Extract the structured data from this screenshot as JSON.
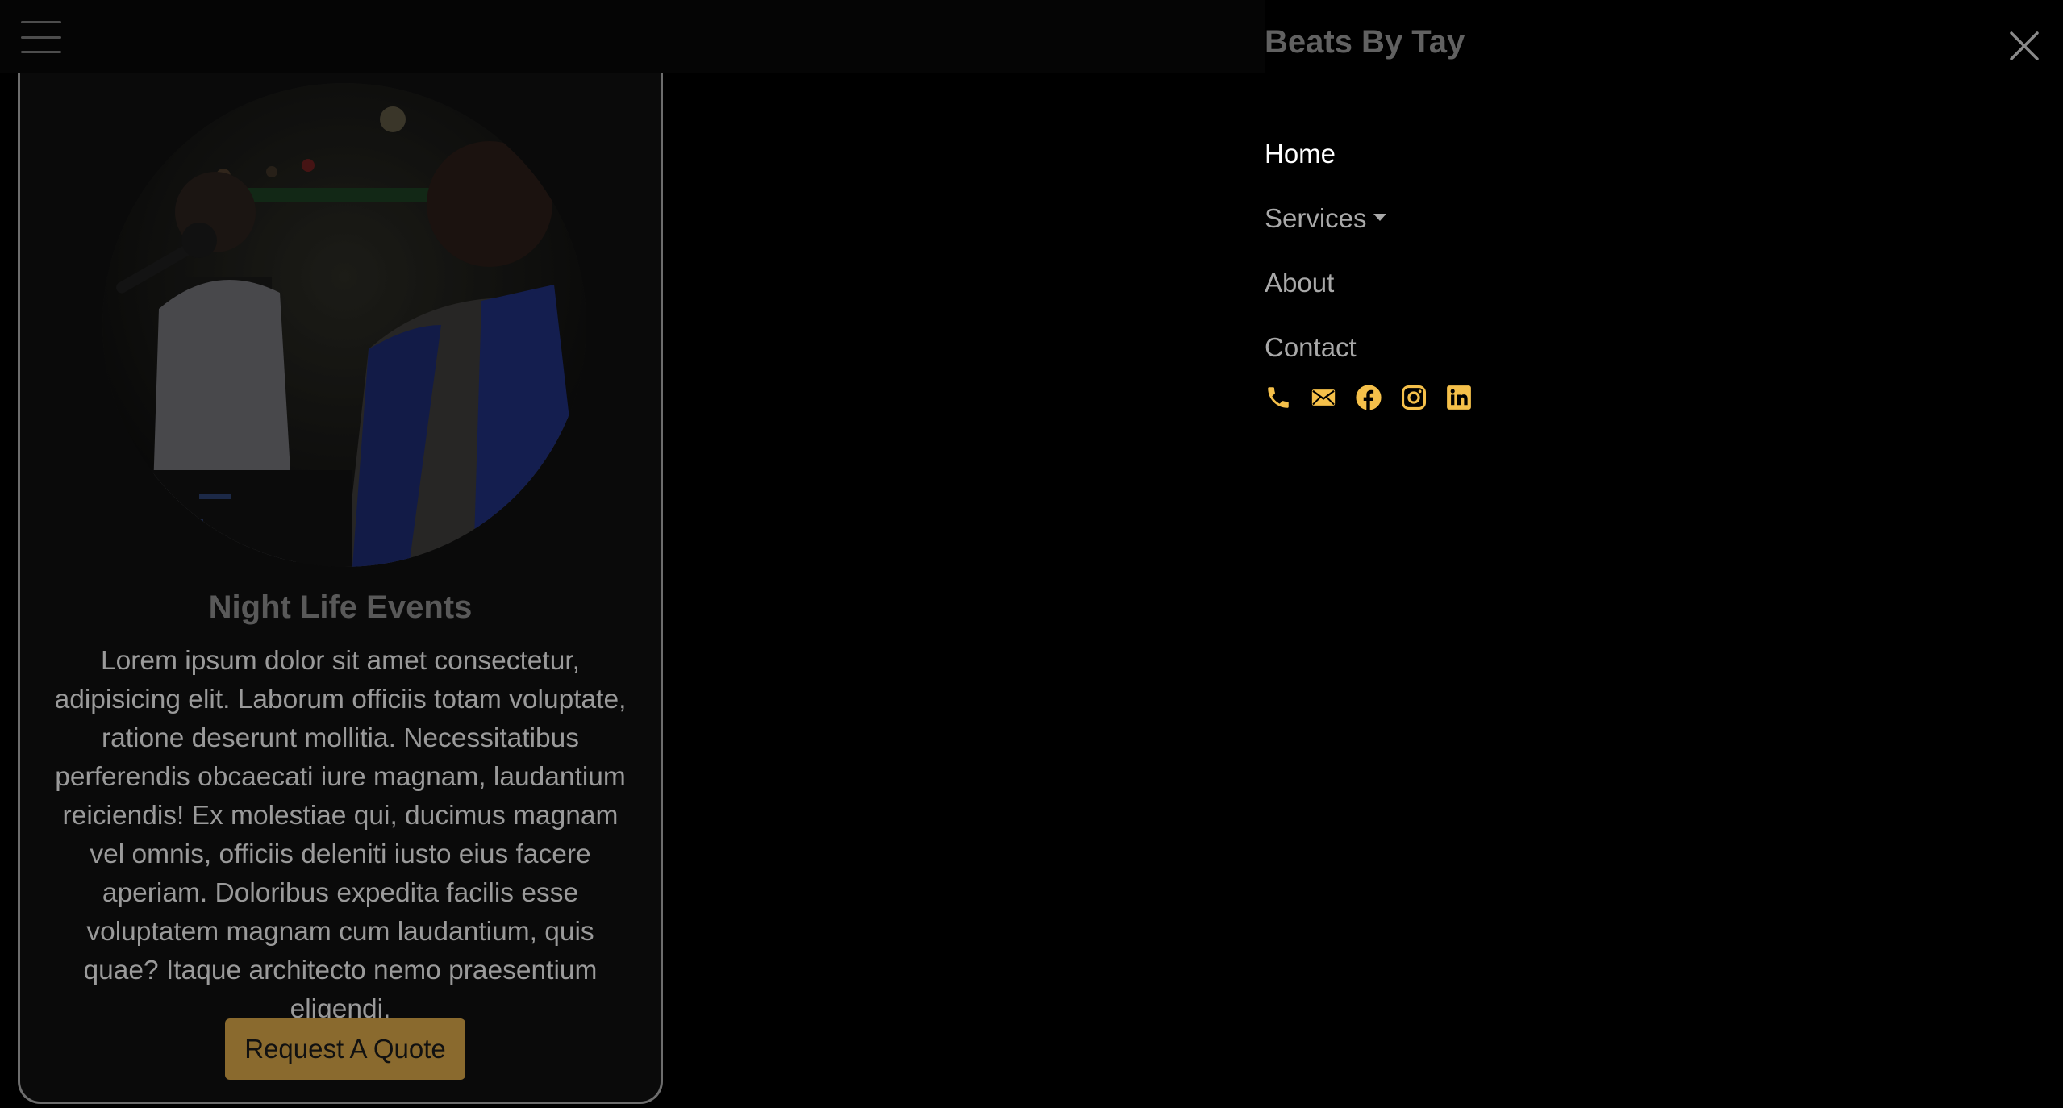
{
  "navbar": {
    "menu_toggle_icon": "hamburger-icon"
  },
  "card": {
    "image_alt": "DJ performing at night life event",
    "title": "Night Life Events",
    "text": "Lorem ipsum dolor sit amet consectetur, adipisicing elit. Laborum officiis totam voluptate, ratione deserunt mollitia. Necessitatibus perferendis obcaecati iure magnam, laudantium reiciendis! Ex molestiae qui, ducimus magnam vel omnis, officiis deleniti iusto eius facere aperiam. Doloribus expedita facilis esse voluptatem magnam cum laudantium, quis quae? Itaque architecto nemo praesentium eligendi.",
    "button_label": "Request A Quote"
  },
  "offcanvas": {
    "brand": "Beats By Tay",
    "close_icon": "close-icon",
    "menu": [
      {
        "label": "Home"
      },
      {
        "label": "Services"
      },
      {
        "label": "About"
      },
      {
        "label": "Contact"
      }
    ],
    "social_icons": [
      "phone-icon",
      "mail-icon",
      "facebook-icon",
      "instagram-icon",
      "linkedin-icon"
    ]
  },
  "colors": {
    "accent": "#f5c04a",
    "button_bg_dimmed": "#8a6a2e",
    "active_link": "#ffffff",
    "muted_link": "#a9a9a9"
  }
}
